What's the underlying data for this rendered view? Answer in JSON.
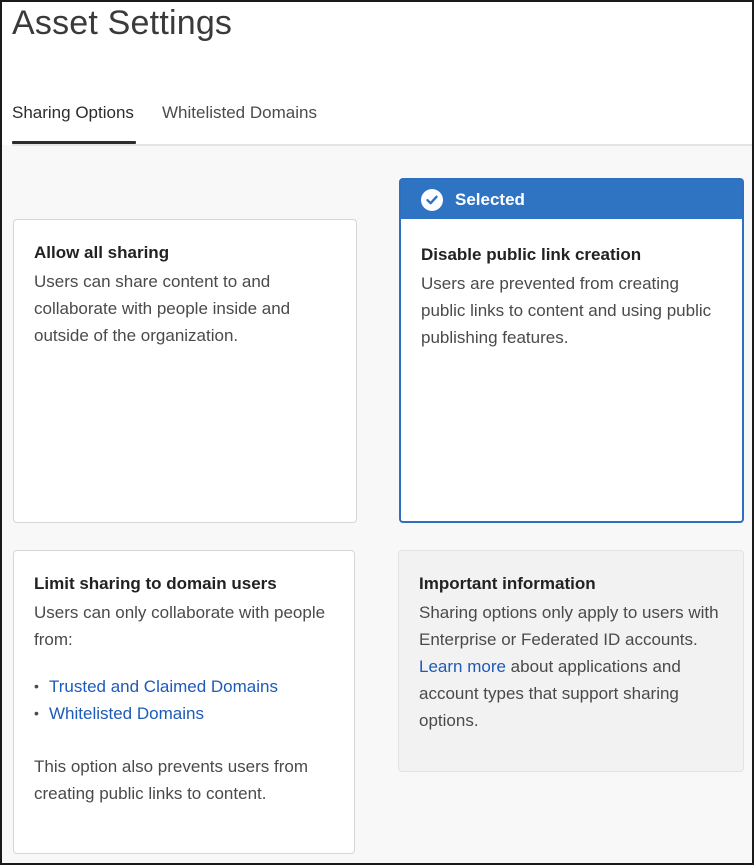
{
  "header": {
    "title": "Asset Settings"
  },
  "tabs": [
    {
      "label": "Sharing Options",
      "active": true
    },
    {
      "label": "Whitelisted Domains",
      "active": false
    }
  ],
  "cards": {
    "allow": {
      "title": "Allow all sharing",
      "description": "Users can share content to and collaborate with people inside and outside of the organization."
    },
    "disable": {
      "selected_label": "Selected",
      "title": "Disable public link creation",
      "description": "Users are prevented from creating public links to content and using public publishing features."
    },
    "limit": {
      "title": "Limit sharing to domain users",
      "description": "Users can only collaborate with people from:",
      "bullets": [
        "Trusted and Claimed Domains",
        "Whitelisted Domains"
      ],
      "note": "This option also prevents users from creating public links to content."
    }
  },
  "info": {
    "title": "Important information",
    "text_before_link": "Sharing options only apply to users with Enterprise or Federated ID accounts.",
    "link_label": "Learn more",
    "text_after_link": "about applications and account types that support sharing options."
  },
  "colors": {
    "accent": "#2f74c3",
    "link": "#1d5ab9"
  },
  "icons": {
    "selected": "checkmark-circle-icon"
  }
}
